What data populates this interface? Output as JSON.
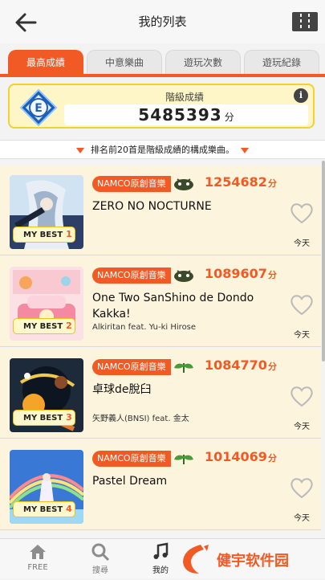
{
  "header": {
    "title": "我的列表"
  },
  "tabs": [
    {
      "label": "最高成績",
      "active": true
    },
    {
      "label": "中意樂曲",
      "active": false
    },
    {
      "label": "遊玩次數",
      "active": false
    },
    {
      "label": "遊玩紀錄",
      "active": false
    }
  ],
  "grade": {
    "label": "階級成績",
    "score": "5485393",
    "unit": "分",
    "rank_letter": "E",
    "info": "i"
  },
  "notice": "排名前20首是階級成績的構成樂曲。",
  "songs": [
    {
      "tag": "NAMCO原創音樂",
      "score": "1254682",
      "unit": "分",
      "title": "ZERO NO NOCTURNE",
      "artist": "",
      "mybest": "MY BEST",
      "rank": "1",
      "date": "今天"
    },
    {
      "tag": "NAMCO原創音樂",
      "score": "1089607",
      "unit": "分",
      "title": "One Two SanShino de Dondo Kakka!",
      "artist": "Alkiritan feat. Yu-ki Hirose",
      "mybest": "MY BEST",
      "rank": "2",
      "date": "今天"
    },
    {
      "tag": "NAMCO原創音樂",
      "score": "1084770",
      "unit": "分",
      "title": "卓球de脫臼",
      "artist": "矢野義人(BNSI) feat. 金太",
      "mybest": "MY BEST",
      "rank": "3",
      "date": "今天"
    },
    {
      "tag": "NAMCO原創音樂",
      "score": "1014069",
      "unit": "分",
      "title": "Pastel Dream",
      "artist": "",
      "mybest": "MY BEST",
      "rank": "4",
      "date": "今天"
    }
  ],
  "nav": [
    {
      "label": "FREE",
      "icon": "home-icon"
    },
    {
      "label": "搜尋",
      "icon": "search-icon"
    },
    {
      "label": "我的",
      "icon": "music-note-icon"
    }
  ],
  "watermark": {
    "text": "健宇软件园"
  },
  "colors": {
    "accent": "#f15a24",
    "gold": "#f2d230",
    "row_bg": "#fdf4de"
  }
}
